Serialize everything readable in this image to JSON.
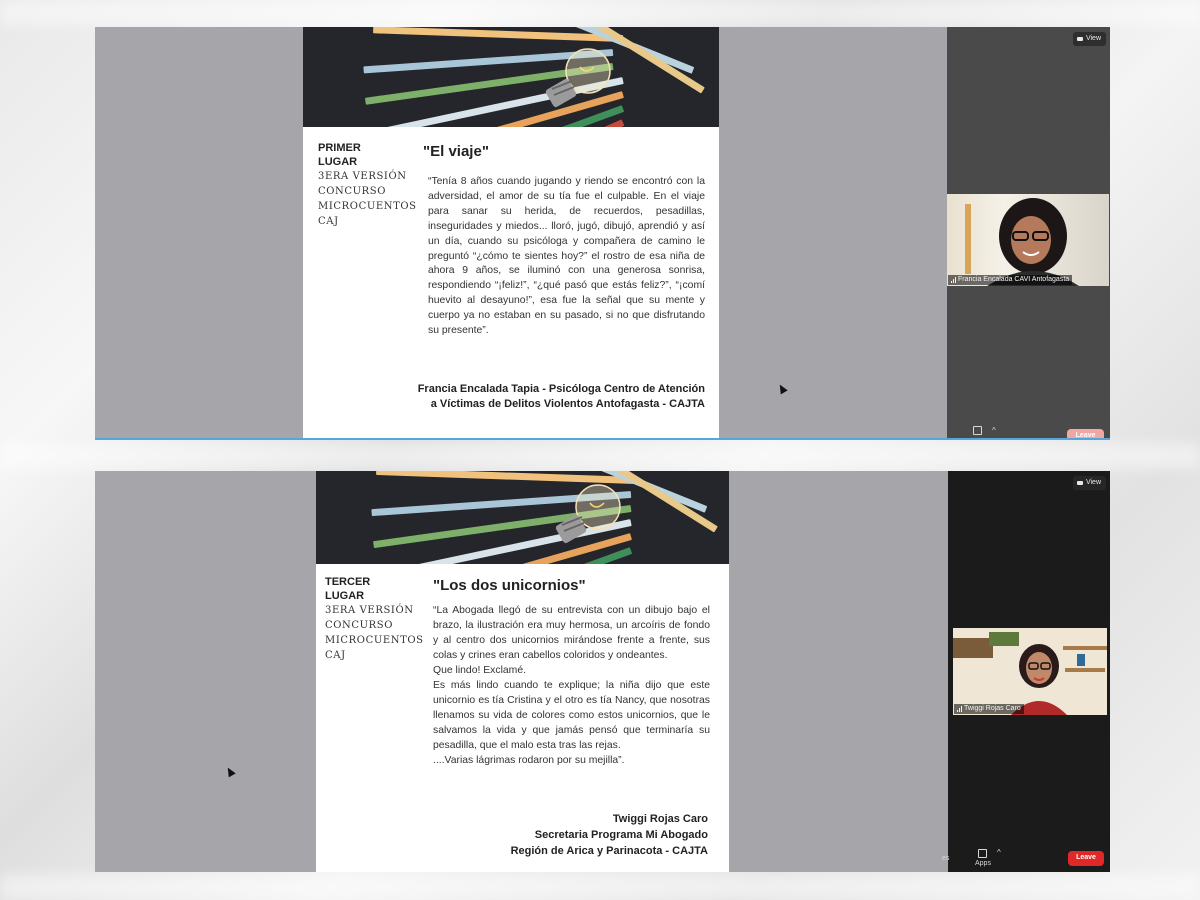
{
  "top_slide": {
    "place_bold": [
      "PRIMER",
      "LUGAR"
    ],
    "place_sub": [
      "3ERA VERSIÓN",
      "CONCURSO",
      "MICROCUENTOS",
      "CAJ"
    ],
    "title": "\"El viaje\"",
    "story": "“Tenía 8 años cuando jugando y riendo se encontró con la adversidad, el amor de su tía fue el culpable. En el viaje para sanar su herida, de recuerdos, pesadillas, inseguridades y miedos... lloró, jugó, dibujó, aprendió y así un día, cuando su psicóloga y compañera de camino le preguntó “¿cómo te sientes hoy?” el rostro de esa niña de ahora 9 años, se iluminó con una generosa sonrisa, respondiendo “¡feliz!”, “¿qué pasó que estás feliz?”, “¡comí huevito al desayuno!”, esa fue la señal que su mente y cuerpo ya no estaban en su pasado, si no que disfrutando su presente”.",
    "author_lines": [
      "Francia Encalada Tapia - Psicóloga Centro de Atención",
      "a Víctimas  de Delitos Violentos Antofagasta - CAJTA"
    ]
  },
  "top_panel": {
    "view_label": "View",
    "participant_name": "Francia Encalada CAVI Antofagasta",
    "leave_label": "Leave"
  },
  "bottom_slide": {
    "place_bold": [
      "TERCER",
      "LUGAR"
    ],
    "place_sub": [
      "3ERA VERSIÓN",
      "CONCURSO",
      "MICROCUENTOS",
      "CAJ"
    ],
    "title": "\"Los dos unicornios\"",
    "story_paragraphs": [
      "“La Abogada llegó de su entrevista con un dibujo bajo el brazo, la ilustración era muy hermosa, un arcoíris de fondo y al centro dos unicornios mirándose frente a frente, sus colas y crines eran cabellos coloridos y ondeantes.",
      "Que lindo! Exclamé.",
      "Es más lindo cuando te explique; la niña dijo que este unicornio es tía Cristina y el otro es tía Nancy, que nosotras llenamos su vida de colores como estos unicornios, que le salvamos la vida y que jamás pensó que terminaría su pesadilla, que el malo esta tras las rejas.",
      "....Varias lágrimas rodaron por su mejilla”."
    ],
    "author_lines": [
      "Twiggi Rojas Caro",
      "Secretaria Programa Mi Abogado",
      "Región de Arica y Parinacota - CAJTA"
    ]
  },
  "bottom_panel": {
    "view_label": "View",
    "participant_name": "Twiggi Rojas Caro",
    "apps_label": "Apps",
    "cut_label": "es",
    "leave_label": "Leave"
  },
  "colors": {
    "share_background": "#a6a5a9",
    "top_panel": "#4a4a4a",
    "bottom_panel": "#1b1b1b",
    "leave_red": "#e02828",
    "divider_blue": "#55a6de"
  }
}
